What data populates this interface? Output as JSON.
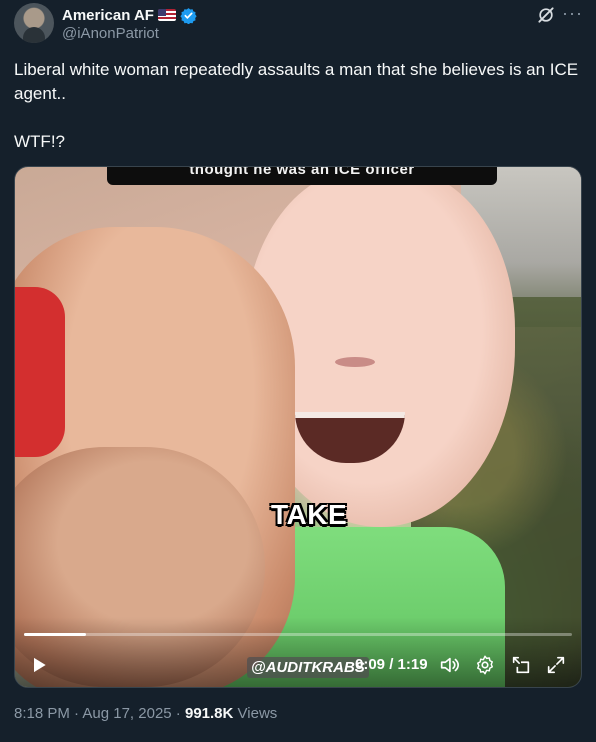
{
  "author": {
    "display_name": "American AF",
    "handle": "@iAnonPatriot"
  },
  "tweet": {
    "line1": "Liberal white woman repeatedly assaults a man that she believes is an ICE agent..",
    "line2": "WTF!?"
  },
  "video": {
    "top_caption": "thought he was an ICE officer",
    "subtitle": "TAKE",
    "watermark": "@AUDITKRABS",
    "current_time": "0:09",
    "duration": "1:19",
    "time_display": "0:09 / 1:19",
    "progress_fraction": 0.114
  },
  "meta": {
    "time": "8:18 PM",
    "separator1": " · ",
    "date": "Aug 17, 2025",
    "separator2": " · ",
    "views_count": "991.8K",
    "views_label": "Views"
  },
  "colors": {
    "background": "#15202b",
    "text_primary": "#f7f9f9",
    "text_secondary": "#8b98a5",
    "verified_blue": "#1d9bf0"
  },
  "icons": [
    "verified-badge-icon",
    "flag-us-icon",
    "grok-icon",
    "more-icon",
    "play-icon",
    "volume-icon",
    "settings-icon",
    "pip-icon",
    "fullscreen-icon"
  ]
}
